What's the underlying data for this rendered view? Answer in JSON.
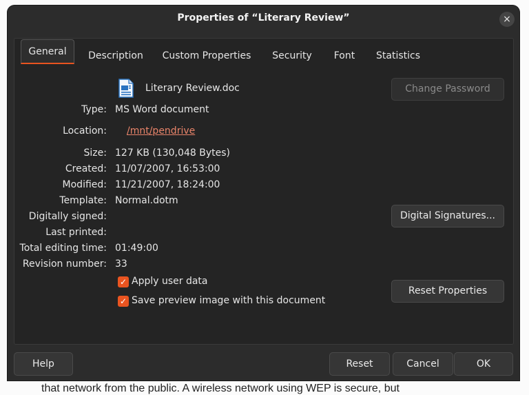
{
  "background_doc": {
    "visible_text": "that network from the public. A wireless network using WEP is secure, but"
  },
  "dialog": {
    "title": "Properties of “Literary Review”",
    "close_label": "×"
  },
  "tabs": [
    {
      "label": "General",
      "active": true
    },
    {
      "label": "Description"
    },
    {
      "label": "Custom Properties"
    },
    {
      "label": "Security"
    },
    {
      "label": "Font"
    },
    {
      "label": "Statistics"
    }
  ],
  "general": {
    "file_name": "Literary Review.doc",
    "file_icon": "document-icon",
    "fields": {
      "type": {
        "label": "Type:",
        "value": "MS Word document"
      },
      "location": {
        "label": "Location:",
        "value": "/mnt/pendrive"
      },
      "size": {
        "label": "Size:",
        "value": "127 KB (130,048 Bytes)"
      },
      "created": {
        "label": "Created:",
        "value": "11/07/2007, 16:53:00"
      },
      "modified": {
        "label": "Modified:",
        "value": "11/21/2007, 18:24:00"
      },
      "template": {
        "label": "Template:",
        "value": "Normal.dotm"
      },
      "digitally_signed": {
        "label": "Digitally signed:",
        "value": ""
      },
      "last_printed": {
        "label": "Last printed:",
        "value": ""
      },
      "total_editing_time": {
        "label": "Total editing time:",
        "value": "01:49:00"
      },
      "revision_number": {
        "label": "Revision number:",
        "value": "33"
      }
    },
    "checkboxes": {
      "apply_user_data": {
        "label": "Apply user data",
        "checked": true
      },
      "save_preview": {
        "label": "Save preview image with this document",
        "checked": true
      }
    },
    "buttons": {
      "change_password": "Change Password",
      "digital_signatures": "Digital Signatures...",
      "reset_properties": "Reset Properties"
    }
  },
  "footer": {
    "help": "Help",
    "reset": "Reset",
    "cancel": "Cancel",
    "ok": "OK"
  },
  "colors": {
    "accent": "#e95420",
    "link": "#e9846a",
    "dialog_bg": "#2c2c2c",
    "panel_bg": "#242424"
  }
}
